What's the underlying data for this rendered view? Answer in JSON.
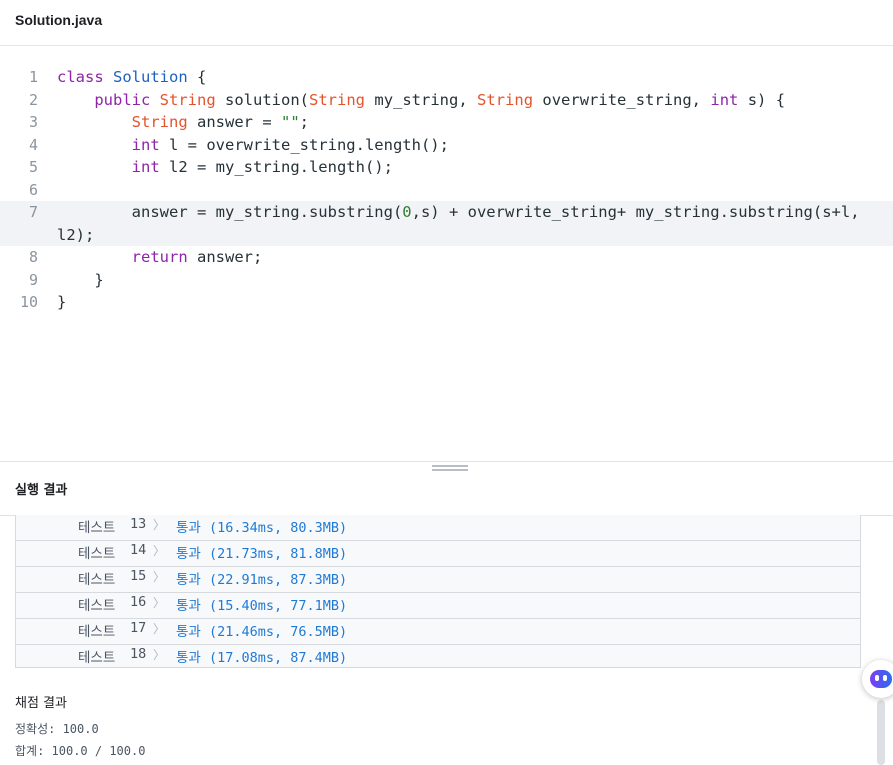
{
  "file": {
    "title": "Solution.java"
  },
  "editor": {
    "lines": [
      {
        "n": "1"
      },
      {
        "n": "2"
      },
      {
        "n": "3"
      },
      {
        "n": "4"
      },
      {
        "n": "5"
      },
      {
        "n": "6"
      },
      {
        "n": "7"
      },
      {
        "n": "8"
      },
      {
        "n": "9"
      },
      {
        "n": "10"
      }
    ],
    "tokens": {
      "l1": [
        "class",
        "Solution",
        "{"
      ],
      "l2": [
        "public",
        "String",
        "solution(",
        "String",
        "my_string,",
        "String",
        "overwrite_string,",
        "int",
        "s) {"
      ],
      "l3": [
        "String",
        "answer =",
        "\"\"",
        ";"
      ],
      "l4": [
        "int",
        "l = overwrite_string.length();"
      ],
      "l5": [
        "int",
        "l2 = my_string.length();"
      ],
      "l7a": [
        "answer = my_string.substring(",
        "0",
        ",s) + overwrite_string+ my_string.substring(s+l,"
      ],
      "l7b": [
        "l2);"
      ],
      "l8": [
        "return",
        "answer;"
      ],
      "l9": [
        "}"
      ],
      "l10": [
        "}"
      ]
    }
  },
  "results": {
    "title": "실행 결과",
    "tests": [
      {
        "label": "테스트",
        "num": "13",
        "chevron": "〉",
        "result": "통과 (16.34ms, 80.3MB)"
      },
      {
        "label": "테스트",
        "num": "14",
        "chevron": "〉",
        "result": "통과 (21.73ms, 81.8MB)"
      },
      {
        "label": "테스트",
        "num": "15",
        "chevron": "〉",
        "result": "통과 (22.91ms, 87.3MB)"
      },
      {
        "label": "테스트",
        "num": "16",
        "chevron": "〉",
        "result": "통과 (15.40ms, 77.1MB)"
      },
      {
        "label": "테스트",
        "num": "17",
        "chevron": "〉",
        "result": "통과 (21.46ms, 76.5MB)"
      },
      {
        "label": "테스트",
        "num": "18",
        "chevron": "〉",
        "result": "통과 (17.08ms, 87.4MB)"
      }
    ]
  },
  "grading": {
    "title": "채점 결과",
    "accuracy": "정확성: 100.0",
    "total": "합계: 100.0 / 100.0"
  },
  "icons": {
    "bot": "chatbot-icon",
    "splitter": "drag-handle-icon",
    "chevron": "chevron-right-icon"
  },
  "colors": {
    "keyword": "#8e24aa",
    "type": "#e5532d",
    "class": "#1f5fbf",
    "pass": "#1f7ad6"
  }
}
